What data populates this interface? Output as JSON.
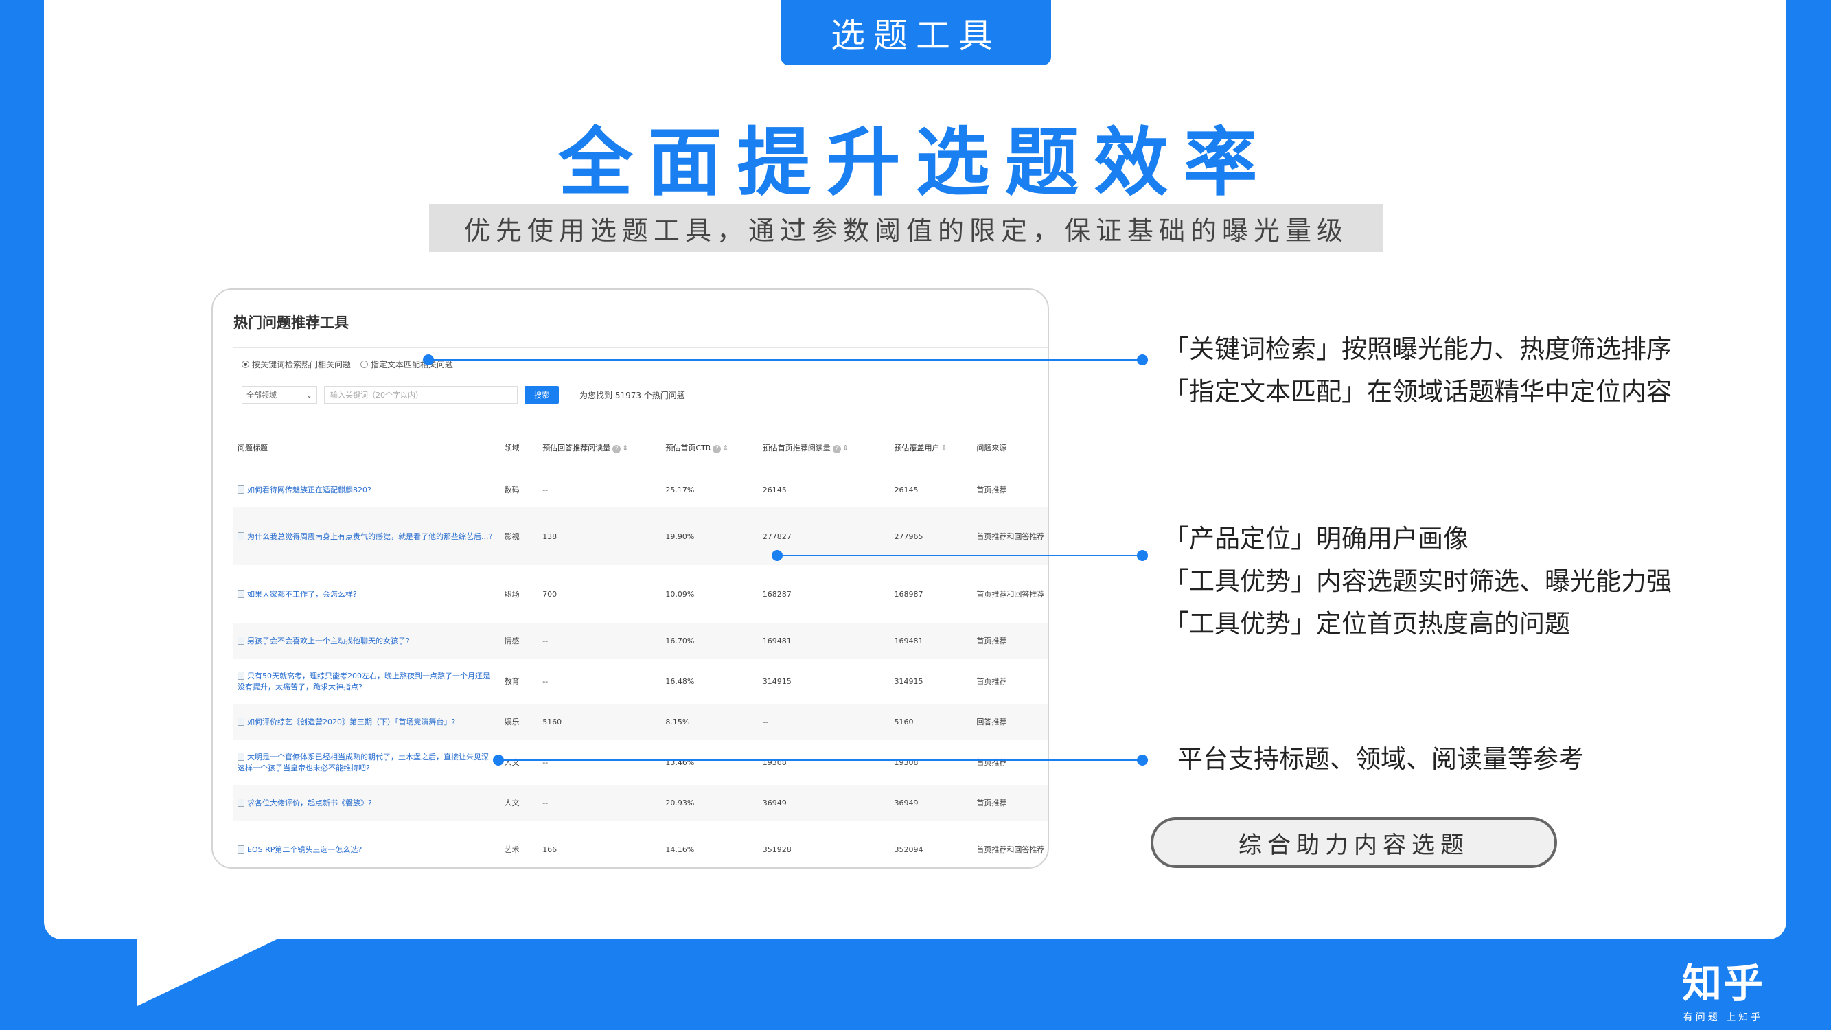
{
  "tab_label": "选题工具",
  "headline": "全面提升选题效率",
  "subtitle": "优先使用选题工具，通过参数阈值的限定，保证基础的曝光量级",
  "panel": {
    "title": "热门问题推荐工具",
    "radio_keyword": "按关键词检索热门相关问题",
    "radio_text": "指定文本匹配相关问题",
    "domain_select": "全部领域",
    "keyword_placeholder": "输入关键词（20个字以内）",
    "search_button": "搜索",
    "result_count": "为您找到 51973 个热门问题",
    "columns": [
      "问题标题",
      "领域",
      "预估回答推荐阅读量",
      "预估首页CTR",
      "预估首页推荐阅读量",
      "预估覆盖用户",
      "问题来源"
    ],
    "rows": [
      {
        "title": "如何看待网传魅族正在适配麒麟820?",
        "domain": "数码",
        "answer_reads": "--",
        "ctr": "25.17%",
        "home_reads": "26145",
        "users": "26145",
        "source": "首页推荐"
      },
      {
        "title": "为什么我总觉得周震南身上有点贵气的感觉，就是看了他的那些综艺后...?",
        "domain": "影视",
        "answer_reads": "138",
        "ctr": "19.90%",
        "home_reads": "277827",
        "users": "277965",
        "source": "首页推荐和回答推荐"
      },
      {
        "title": "如果大家都不工作了，会怎么样?",
        "domain": "职场",
        "answer_reads": "700",
        "ctr": "10.09%",
        "home_reads": "168287",
        "users": "168987",
        "source": "首页推荐和回答推荐"
      },
      {
        "title": "男孩子会不会喜欢上一个主动找他聊天的女孩子?",
        "domain": "情感",
        "answer_reads": "--",
        "ctr": "16.70%",
        "home_reads": "169481",
        "users": "169481",
        "source": "首页推荐"
      },
      {
        "title": "只有50天就高考，理综只能考200左右，晚上熬夜到一点熬了一个月还是没有提升，太痛苦了，跪求大神指点?",
        "domain": "教育",
        "answer_reads": "--",
        "ctr": "16.48%",
        "home_reads": "314915",
        "users": "314915",
        "source": "首页推荐"
      },
      {
        "title": "如何评价综艺《创造营2020》第三期（下）「首场竞演舞台」?",
        "domain": "娱乐",
        "answer_reads": "5160",
        "ctr": "8.15%",
        "home_reads": "--",
        "users": "5160",
        "source": "回答推荐"
      },
      {
        "title": "大明是一个官僚体系已经相当成熟的朝代了，土木堡之后，直接让朱见深这样一个孩子当皇帝也未必不能维持吧?",
        "domain": "人文",
        "answer_reads": "--",
        "ctr": "13.46%",
        "home_reads": "19308",
        "users": "19308",
        "source": "首页推荐"
      },
      {
        "title": "求各位大佬评价，起点新书《磐族》?",
        "domain": "人文",
        "answer_reads": "--",
        "ctr": "20.93%",
        "home_reads": "36949",
        "users": "36949",
        "source": "首页推荐"
      },
      {
        "title": "EOS RP第二个镜头三选一怎么选?",
        "domain": "艺术",
        "answer_reads": "166",
        "ctr": "14.16%",
        "home_reads": "351928",
        "users": "352094",
        "source": "首页推荐和回答推荐"
      }
    ]
  },
  "callouts": {
    "group1": [
      "「关键词检索」按照曝光能力、热度筛选排序",
      "「指定文本匹配」在领域话题精华中定位内容"
    ],
    "group2": [
      "「产品定位」明确用户画像",
      "「工具优势」内容选题实时筛选、曝光能力强",
      "「工具优势」定位首页热度高的问题"
    ],
    "group3": [
      "平台支持标题、领域、阅读量等参考"
    ]
  },
  "pill_label": "综合助力内容选题",
  "logo": {
    "main": "知乎",
    "sub": "有问题 上知乎"
  },
  "colors": {
    "brand_blue": "#1a7ff0",
    "link_blue": "#2b6fcf"
  }
}
